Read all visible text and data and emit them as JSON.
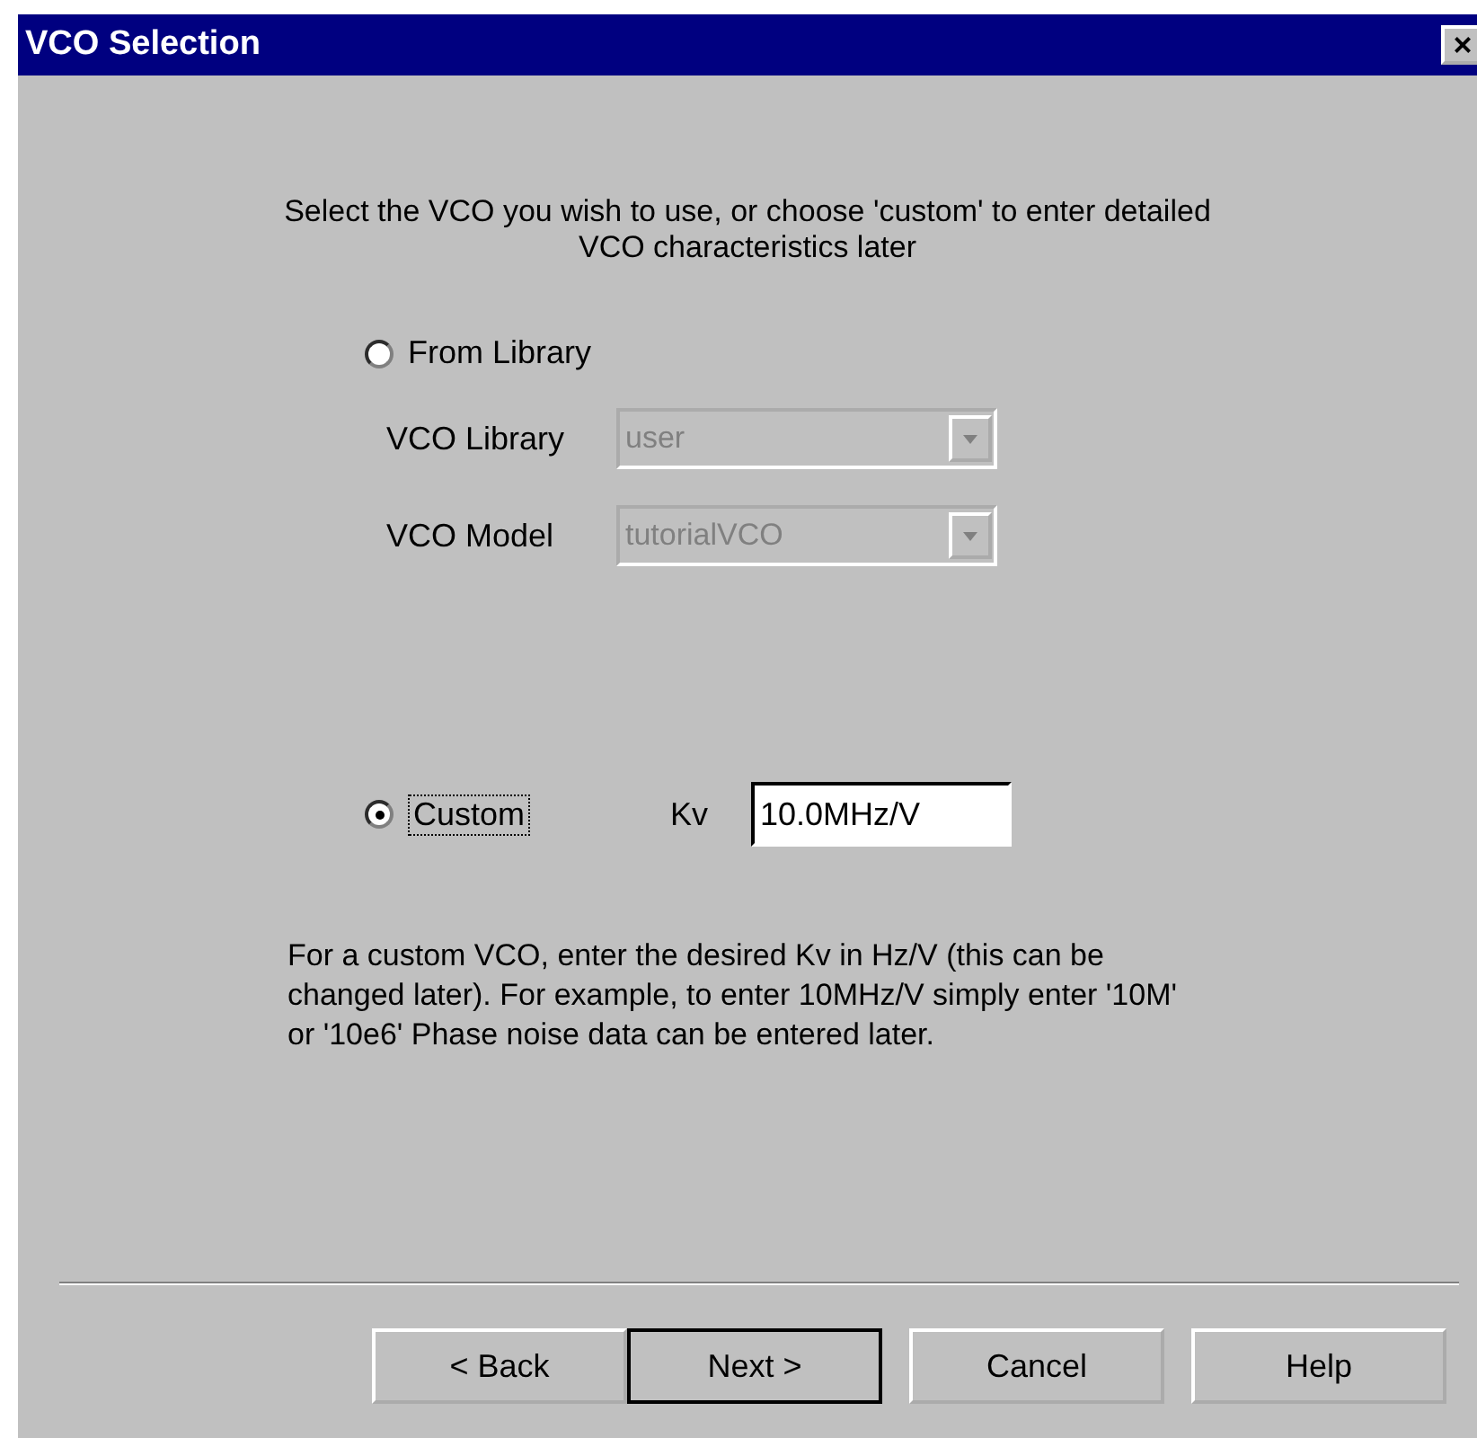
{
  "window": {
    "title": "VCO Selection",
    "close": "×"
  },
  "intro": "Select the VCO you wish to use,  or choose  'custom' to enter detailed VCO characteristics later",
  "options": [
    {
      "kind": "library",
      "label": "From Library",
      "selected": false
    },
    {
      "kind": "custom",
      "label": "Custom",
      "selected": true
    }
  ],
  "library_fields": [
    {
      "label": "VCO Library",
      "value": "user",
      "disabled": true
    },
    {
      "label": "VCO Model",
      "value": "tutorialVCO",
      "disabled": true
    }
  ],
  "kv": {
    "label": "Kv",
    "value": "10.0MHz/V"
  },
  "help_text": "For a custom VCO,  enter the desired Kv in Hz/V (this can be changed later).   For example,  to enter 10MHz/V simply enter '10M' or '10e6'  Phase noise data can be entered later.",
  "buttons": [
    {
      "label": "< Back",
      "default": false
    },
    {
      "label": "Next >",
      "default": true
    },
    {
      "label": "Cancel",
      "default": false
    },
    {
      "label": "Help",
      "default": false
    }
  ]
}
